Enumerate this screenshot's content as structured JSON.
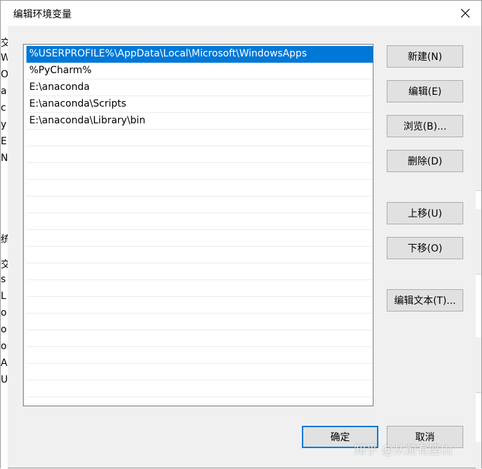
{
  "dialog": {
    "title": "编辑环境变量",
    "close_glyph": "✕"
  },
  "path_list": {
    "items": [
      "%USERPROFILE%\\AppData\\Local\\Microsoft\\WindowsApps",
      "%PyCharm%",
      "E:\\anaconda",
      "E:\\anaconda\\Scripts",
      "E:\\anaconda\\Library\\bin"
    ],
    "selected_index": 0
  },
  "buttons": {
    "new": "新建(N)",
    "edit": "编辑(E)",
    "browse": "浏览(B)...",
    "delete": "删除(D)",
    "move_up": "上移(U)",
    "move_down": "下移(O)",
    "edit_text": "编辑文本(T)...",
    "ok": "确定",
    "cancel": "取消"
  },
  "background_fragments": [
    "交",
    "W",
    "Or",
    "a",
    "c",
    "y",
    "E",
    "N",
    "统",
    "交",
    "s",
    "L",
    "o",
    "o",
    "or",
    "A",
    "U"
  ],
  "watermark": "知乎 @从前有座山",
  "colors": {
    "selection": "#0078d7",
    "default_button_border": "#0078d7",
    "button_face": "#e1e1e1",
    "dialog_bg": "#f0f0f0"
  }
}
